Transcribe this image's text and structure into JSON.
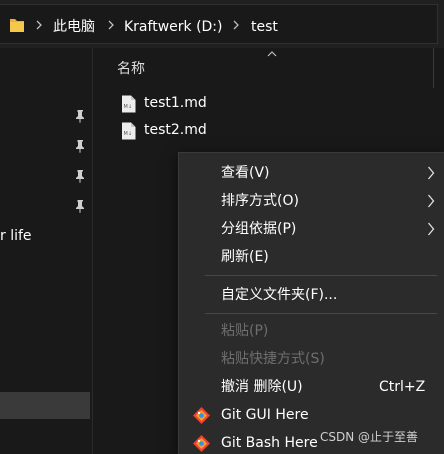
{
  "address_bar": {
    "breadcrumbs": [
      "此电脑",
      "Kraftwerk (D:)",
      "test"
    ],
    "folder_icon": "folder-icon"
  },
  "nav_pane": {
    "partial_text": "r life",
    "pinned_icons": [
      "pin-icon",
      "pin-icon",
      "pin-icon",
      "pin-icon"
    ]
  },
  "content": {
    "column_header": "名称",
    "files": [
      {
        "name": "test1.md",
        "icon": "markdown-file-icon"
      },
      {
        "name": "test2.md",
        "icon": "markdown-file-icon"
      }
    ]
  },
  "context_menu": {
    "items": [
      {
        "label": "查看(V)",
        "submenu": true,
        "disabled": false
      },
      {
        "label": "排序方式(O)",
        "submenu": true,
        "disabled": false
      },
      {
        "label": "分组依据(P)",
        "submenu": true,
        "disabled": false
      },
      {
        "label": "刷新(E)",
        "submenu": false,
        "disabled": false
      },
      {
        "label": "自定义文件夹(F)...",
        "submenu": false,
        "disabled": false
      },
      {
        "label": "粘贴(P)",
        "submenu": false,
        "disabled": true
      },
      {
        "label": "粘贴快捷方式(S)",
        "submenu": false,
        "disabled": true
      },
      {
        "label": "撤消 删除(U)",
        "shortcut": "Ctrl+Z",
        "submenu": false,
        "disabled": false
      },
      {
        "label": "Git GUI Here",
        "icon": "git-icon",
        "submenu": false,
        "disabled": false
      },
      {
        "label": "Git Bash Here",
        "icon": "git-icon",
        "submenu": false,
        "disabled": false
      }
    ]
  },
  "watermark": "CSDN @止于至善",
  "colors": {
    "background": "#191919",
    "menu_background": "#2b2b2b",
    "folder_yellow": "#e8b23a",
    "disabled_text": "#6e6e6e"
  }
}
